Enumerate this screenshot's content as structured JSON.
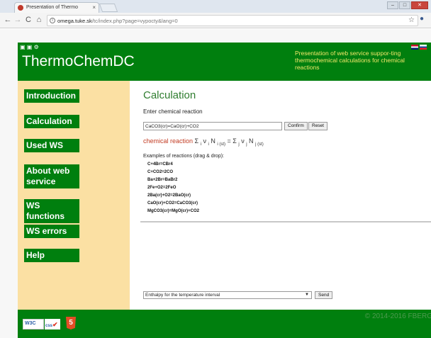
{
  "browser": {
    "tab_title": "Presentation of Thermo",
    "tab_close": "×",
    "url_host": "omega.tuke.sk",
    "url_path": "/tc/index.php?page=vypocty&lang=0",
    "back": "←",
    "forward": "→",
    "reload": "C",
    "home": "⌂",
    "star": "☆",
    "window_min": "–",
    "window_max": "□",
    "window_close": "✕"
  },
  "header": {
    "logo": "ThermoChemDC",
    "tagline": "Presentation of web service suppor-ting thermochemical calculations for chemical reactions"
  },
  "sidebar": {
    "items": [
      {
        "label": "Introduction"
      },
      {
        "label": "Calculation"
      },
      {
        "label": "Used WS"
      },
      {
        "label": "About web service"
      },
      {
        "label": "WS functions"
      },
      {
        "label": "WS errors"
      },
      {
        "label": "Help"
      }
    ]
  },
  "main": {
    "title": "Calculation",
    "subtitle": "Enter chemical reaction",
    "reaction_value": "CaCO3(cr)=CaO(cr)+CO2",
    "confirm_label": "Confirm",
    "reset_label": "Reset",
    "formula_label": "chemical reaction",
    "examples_label": "Examples of reactions (drag & drop):",
    "examples": [
      "C+4Br=CBr4",
      "C+CO2=2CO",
      "Ba+2Br=BaBr2",
      "2Fe+O2=2FeO",
      "2Ba(cr)+O2=2BaO(cr)",
      "CaO(cr)+CO2=CaCO3(cr)",
      "MgCO3(cr)=MgO(cr)+CO2"
    ],
    "select_value": "Enthalpy for the temperature interval",
    "send_label": "Send"
  },
  "footer": {
    "w3c_label": "W3C",
    "css_label": "css",
    "html5_label": "5",
    "copyright": "© 2014-2016 FBERG"
  },
  "colors": {
    "brand_green": "#007f0e",
    "sidebar_bg": "#fbe0a3",
    "tagline_yellow": "#f3e76a"
  }
}
